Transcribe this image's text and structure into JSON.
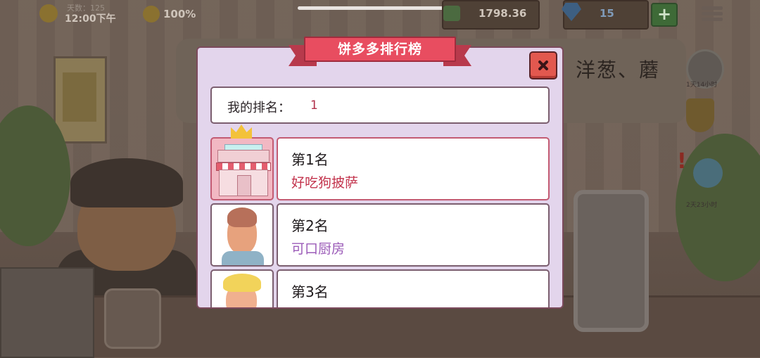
{
  "hud": {
    "day_label": "天数：125",
    "time": "12:00下午",
    "satisfaction": "100%",
    "money": "1798.36",
    "gems": "15",
    "plus_label": "+"
  },
  "background": {
    "side_text": "洋葱、蘑",
    "timer_1": "1天14小时",
    "timer_2": "2天23小时"
  },
  "modal": {
    "title": "饼多多排行榜",
    "close_label": "X",
    "my_rank_label": "我的排名：",
    "my_rank_value": "1",
    "entries": [
      {
        "rank": "第1名",
        "name": "好吃狗披萨",
        "avatar": "shop-icon"
      },
      {
        "rank": "第2名",
        "name": "可口厨房",
        "avatar": "man-avatar-icon"
      },
      {
        "rank": "第3名",
        "name": "",
        "avatar": "blonde-man-avatar-icon"
      }
    ]
  },
  "colors": {
    "accent_red": "#e84d60",
    "name_red": "#c3344d",
    "name_purple": "#9b5bb8",
    "panel": "#e3d5ec"
  }
}
